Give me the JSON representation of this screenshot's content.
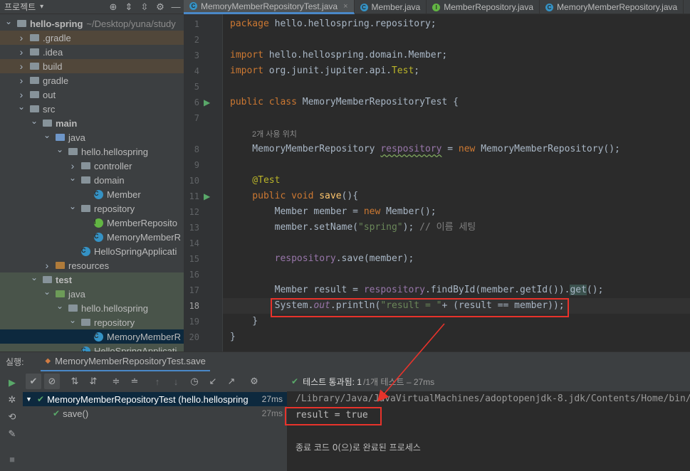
{
  "project_panel": {
    "title": "프로젝트",
    "tree": [
      {
        "label": "hello-spring",
        "suffix": "~/Desktop/yuna/study",
        "level": 0,
        "open": true,
        "icon": "folder-icon",
        "bold": true
      },
      {
        "label": ".gradle",
        "level": 1,
        "open": false,
        "icon": "folder-icon",
        "highlight": "orange"
      },
      {
        "label": ".idea",
        "level": 1,
        "open": false,
        "icon": "folder-icon"
      },
      {
        "label": "build",
        "level": 1,
        "open": false,
        "icon": "folder-icon",
        "highlight": "orange"
      },
      {
        "label": "gradle",
        "level": 1,
        "open": false,
        "icon": "folder-icon"
      },
      {
        "label": "out",
        "level": 1,
        "open": false,
        "icon": "folder-icon"
      },
      {
        "label": "src",
        "level": 1,
        "open": true,
        "icon": "folder-icon"
      },
      {
        "label": "main",
        "level": 2,
        "open": true,
        "icon": "folder-icon",
        "bold": true
      },
      {
        "label": "java",
        "level": 3,
        "open": true,
        "icon": "source-folder-icon"
      },
      {
        "label": "hello.hellospring",
        "level": 4,
        "open": true,
        "icon": "package-icon"
      },
      {
        "label": "controller",
        "level": 5,
        "open": false,
        "icon": "package-icon"
      },
      {
        "label": "domain",
        "level": 5,
        "open": true,
        "icon": "package-icon"
      },
      {
        "label": "Member",
        "level": 6,
        "icon": "class-icon"
      },
      {
        "label": "repository",
        "level": 5,
        "open": true,
        "icon": "package-icon"
      },
      {
        "label": "MemberReposito",
        "level": 6,
        "icon": "interface-icon"
      },
      {
        "label": "MemoryMemberR",
        "level": 6,
        "icon": "class-icon"
      },
      {
        "label": "HelloSpringApplicati",
        "level": 5,
        "icon": "spring-class-icon"
      },
      {
        "label": "resources",
        "level": 3,
        "open": false,
        "icon": "resources-folder-icon"
      },
      {
        "label": "test",
        "level": 2,
        "open": true,
        "icon": "folder-icon",
        "bold": true,
        "highlight": "green"
      },
      {
        "label": "java",
        "level": 3,
        "open": true,
        "icon": "test-folder-icon",
        "highlight": "green"
      },
      {
        "label": "hello.hellospring",
        "level": 4,
        "open": true,
        "icon": "package-icon",
        "highlight": "green"
      },
      {
        "label": "repository",
        "level": 5,
        "open": true,
        "icon": "package-icon",
        "highlight": "green"
      },
      {
        "label": "MemoryMemberR",
        "level": 6,
        "icon": "class-icon",
        "highlight": "selected"
      },
      {
        "label": "HelloSpringApplicati",
        "level": 5,
        "icon": "spring-class-icon",
        "highlight": "green"
      }
    ]
  },
  "editor_tabs": [
    {
      "label": "MemoryMemberRepositoryTest.java",
      "icon": "class-icon",
      "active": true
    },
    {
      "label": "Member.java",
      "icon": "class-icon",
      "active": false
    },
    {
      "label": "MemberRepository.java",
      "icon": "interface-icon",
      "active": false
    },
    {
      "label": "MemoryMemberRepository.java",
      "icon": "class-icon",
      "active": false
    }
  ],
  "editor": {
    "lines": [
      "1",
      "2",
      "3",
      "4",
      "5",
      "6",
      "7",
      "8",
      "9",
      "10",
      "11",
      "12",
      "13",
      "14",
      "15",
      "16",
      "17",
      "18",
      "19",
      "20"
    ],
    "current_line": "18",
    "usage_hint": "2개 사용 위치",
    "code": {
      "l1_kw": "package",
      "l1_rest": " hello.hellospring.repository;",
      "l3_kw": "import",
      "l3_rest": " hello.hellospring.domain.Member;",
      "l4_kw": "import",
      "l4_rest": " org.junit.jupiter.api.",
      "l4_ann": "Test",
      "l4_end": ";",
      "l6_kw": "public class",
      "l6_rest": " MemoryMemberRepositoryTest {",
      "l8_type": "    MemoryMemberRepository ",
      "l8_field": "respository",
      "l8_eq": " = ",
      "l8_new": "new",
      "l8_end": " MemoryMemberRepository();",
      "l10_ann": "    @Test",
      "l11_kw": "    public void",
      "l11_fn": " save",
      "l11_end": "(){",
      "l12_a": "        Member member = ",
      "l12_new": "new",
      "l12_b": " Member();",
      "l13_a": "        member.setName(",
      "l13_str": "\"spring\"",
      "l13_b": "); ",
      "l13_cm": "// 이름 세팅",
      "l15_field": "        respository",
      "l15_rest": ".save(member);",
      "l17_a": "        Member result = ",
      "l17_field": "respository",
      "l17_b": ".findById(member.getId()).",
      "l17_get": "get",
      "l17_c": "();",
      "l18_a": "        System.",
      "l18_out": "out",
      "l18_b": ".println(",
      "l18_str": "\"result = \"",
      "l18_c": "+ (result == member));",
      "l19": "    }",
      "l20": "}"
    }
  },
  "run_panel": {
    "label": "실행:",
    "tab_label": "MemoryMemberRepositoryTest.save",
    "status": {
      "pass": "테스트 통과됨: 1",
      "detail": "/1개 테스트 – 27ms"
    },
    "tests": [
      {
        "label": "MemoryMemberRepositoryTest (hello.hellospring",
        "time": "27ms",
        "selected": true
      },
      {
        "label": "save()",
        "time": "27ms",
        "selected": false
      }
    ],
    "console": {
      "path": "/Library/Java/JavaVirtualMachines/adoptopenjdk-8.jdk/Contents/Home/bin/",
      "output": "result = true",
      "exit": "종료 코드 0(으)로 완료된 프로세스"
    }
  },
  "colors": {
    "annotation": "#e8332b",
    "pass": "#59a869",
    "accent": "#4a88c7"
  }
}
